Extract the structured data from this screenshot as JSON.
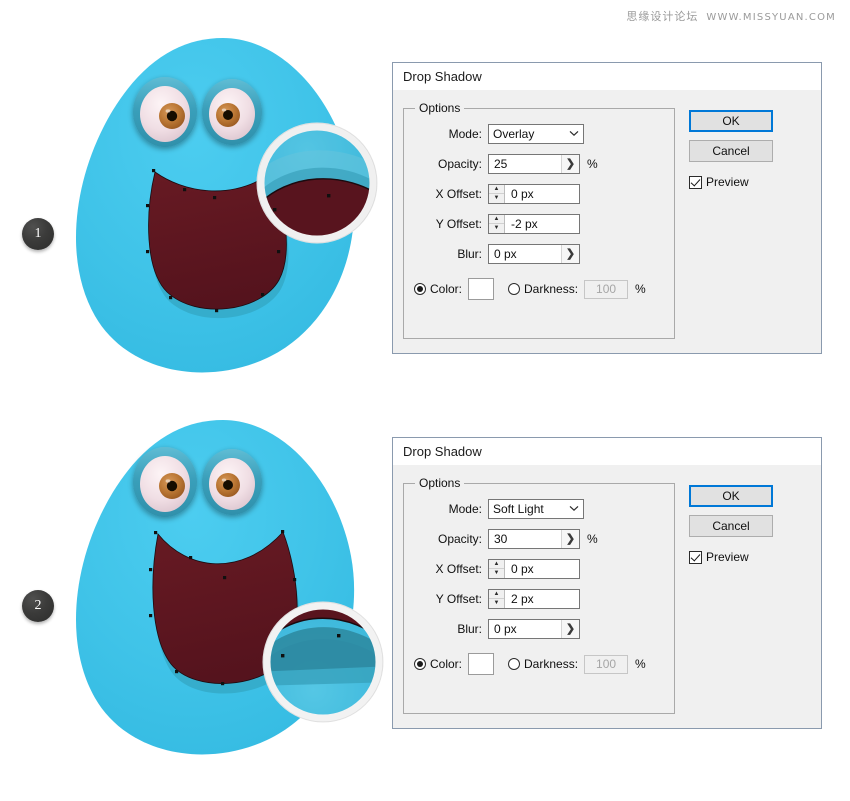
{
  "watermark": {
    "cn": "思缘设计论坛",
    "url": "WWW.MISSYUAN.COM"
  },
  "steps": [
    {
      "number": "1"
    },
    {
      "number": "2"
    }
  ],
  "colors": {
    "body_blue": "#3fc3e8",
    "body_blue_dark": "#2fb6dd",
    "mouth_dark_red": "#5e1620",
    "eye_rim_teal": "#3aa3bd",
    "eye_white": "#f2e2e6",
    "iris_brown": "#c07a3a",
    "pupil_black": "#1a1008",
    "accent_blue": "#0078d7",
    "dialog_bg": "#f0f0f0",
    "dialog_border": "#8a9aae",
    "badge_dark": "#333333"
  },
  "dialogs": [
    {
      "title": "Drop Shadow",
      "group_label": "Options",
      "fields": {
        "mode_label": "Mode:",
        "mode_value": "Overlay",
        "opacity_label": "Opacity:",
        "opacity_value": "25",
        "opacity_unit": "%",
        "x_offset_label": "X Offset:",
        "x_offset_value": "0 px",
        "y_offset_label": "Y Offset:",
        "y_offset_value": "-2 px",
        "blur_label": "Blur:",
        "blur_value": "0 px",
        "color_label": "Color:",
        "color_value": "#ffffff",
        "darkness_label": "Darkness:",
        "darkness_value": "100",
        "darkness_unit": "%"
      },
      "buttons": {
        "ok": "OK",
        "cancel": "Cancel",
        "preview": "Preview"
      }
    },
    {
      "title": "Drop Shadow",
      "group_label": "Options",
      "fields": {
        "mode_label": "Mode:",
        "mode_value": "Soft Light",
        "opacity_label": "Opacity:",
        "opacity_value": "30",
        "opacity_unit": "%",
        "x_offset_label": "X Offset:",
        "x_offset_value": "0 px",
        "y_offset_label": "Y Offset:",
        "y_offset_value": "2 px",
        "blur_label": "Blur:",
        "blur_value": "0 px",
        "color_label": "Color:",
        "color_value": "#ffffff",
        "darkness_label": "Darkness:",
        "darkness_value": "100",
        "darkness_unit": "%"
      },
      "buttons": {
        "ok": "OK",
        "cancel": "Cancel",
        "preview": "Preview"
      }
    }
  ],
  "icons": {
    "chevron_down": "⌄",
    "chevron_right": "❯",
    "spin_up": "▲",
    "spin_down": "▼"
  }
}
